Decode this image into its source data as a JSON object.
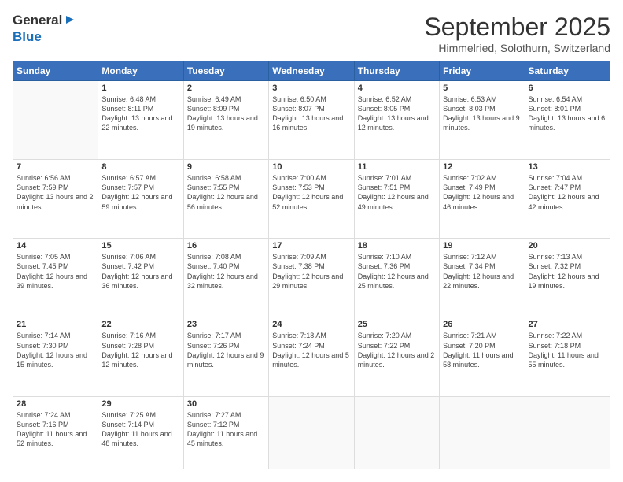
{
  "logo": {
    "general": "General",
    "blue": "Blue"
  },
  "header": {
    "month": "September 2025",
    "location": "Himmelried, Solothurn, Switzerland"
  },
  "weekdays": [
    "Sunday",
    "Monday",
    "Tuesday",
    "Wednesday",
    "Thursday",
    "Friday",
    "Saturday"
  ],
  "weeks": [
    [
      {
        "day": "",
        "info": ""
      },
      {
        "day": "1",
        "info": "Sunrise: 6:48 AM\nSunset: 8:11 PM\nDaylight: 13 hours\nand 22 minutes."
      },
      {
        "day": "2",
        "info": "Sunrise: 6:49 AM\nSunset: 8:09 PM\nDaylight: 13 hours\nand 19 minutes."
      },
      {
        "day": "3",
        "info": "Sunrise: 6:50 AM\nSunset: 8:07 PM\nDaylight: 13 hours\nand 16 minutes."
      },
      {
        "day": "4",
        "info": "Sunrise: 6:52 AM\nSunset: 8:05 PM\nDaylight: 13 hours\nand 12 minutes."
      },
      {
        "day": "5",
        "info": "Sunrise: 6:53 AM\nSunset: 8:03 PM\nDaylight: 13 hours\nand 9 minutes."
      },
      {
        "day": "6",
        "info": "Sunrise: 6:54 AM\nSunset: 8:01 PM\nDaylight: 13 hours\nand 6 minutes."
      }
    ],
    [
      {
        "day": "7",
        "info": "Sunrise: 6:56 AM\nSunset: 7:59 PM\nDaylight: 13 hours\nand 2 minutes."
      },
      {
        "day": "8",
        "info": "Sunrise: 6:57 AM\nSunset: 7:57 PM\nDaylight: 12 hours\nand 59 minutes."
      },
      {
        "day": "9",
        "info": "Sunrise: 6:58 AM\nSunset: 7:55 PM\nDaylight: 12 hours\nand 56 minutes."
      },
      {
        "day": "10",
        "info": "Sunrise: 7:00 AM\nSunset: 7:53 PM\nDaylight: 12 hours\nand 52 minutes."
      },
      {
        "day": "11",
        "info": "Sunrise: 7:01 AM\nSunset: 7:51 PM\nDaylight: 12 hours\nand 49 minutes."
      },
      {
        "day": "12",
        "info": "Sunrise: 7:02 AM\nSunset: 7:49 PM\nDaylight: 12 hours\nand 46 minutes."
      },
      {
        "day": "13",
        "info": "Sunrise: 7:04 AM\nSunset: 7:47 PM\nDaylight: 12 hours\nand 42 minutes."
      }
    ],
    [
      {
        "day": "14",
        "info": "Sunrise: 7:05 AM\nSunset: 7:45 PM\nDaylight: 12 hours\nand 39 minutes."
      },
      {
        "day": "15",
        "info": "Sunrise: 7:06 AM\nSunset: 7:42 PM\nDaylight: 12 hours\nand 36 minutes."
      },
      {
        "day": "16",
        "info": "Sunrise: 7:08 AM\nSunset: 7:40 PM\nDaylight: 12 hours\nand 32 minutes."
      },
      {
        "day": "17",
        "info": "Sunrise: 7:09 AM\nSunset: 7:38 PM\nDaylight: 12 hours\nand 29 minutes."
      },
      {
        "day": "18",
        "info": "Sunrise: 7:10 AM\nSunset: 7:36 PM\nDaylight: 12 hours\nand 25 minutes."
      },
      {
        "day": "19",
        "info": "Sunrise: 7:12 AM\nSunset: 7:34 PM\nDaylight: 12 hours\nand 22 minutes."
      },
      {
        "day": "20",
        "info": "Sunrise: 7:13 AM\nSunset: 7:32 PM\nDaylight: 12 hours\nand 19 minutes."
      }
    ],
    [
      {
        "day": "21",
        "info": "Sunrise: 7:14 AM\nSunset: 7:30 PM\nDaylight: 12 hours\nand 15 minutes."
      },
      {
        "day": "22",
        "info": "Sunrise: 7:16 AM\nSunset: 7:28 PM\nDaylight: 12 hours\nand 12 minutes."
      },
      {
        "day": "23",
        "info": "Sunrise: 7:17 AM\nSunset: 7:26 PM\nDaylight: 12 hours\nand 9 minutes."
      },
      {
        "day": "24",
        "info": "Sunrise: 7:18 AM\nSunset: 7:24 PM\nDaylight: 12 hours\nand 5 minutes."
      },
      {
        "day": "25",
        "info": "Sunrise: 7:20 AM\nSunset: 7:22 PM\nDaylight: 12 hours\nand 2 minutes."
      },
      {
        "day": "26",
        "info": "Sunrise: 7:21 AM\nSunset: 7:20 PM\nDaylight: 11 hours\nand 58 minutes."
      },
      {
        "day": "27",
        "info": "Sunrise: 7:22 AM\nSunset: 7:18 PM\nDaylight: 11 hours\nand 55 minutes."
      }
    ],
    [
      {
        "day": "28",
        "info": "Sunrise: 7:24 AM\nSunset: 7:16 PM\nDaylight: 11 hours\nand 52 minutes."
      },
      {
        "day": "29",
        "info": "Sunrise: 7:25 AM\nSunset: 7:14 PM\nDaylight: 11 hours\nand 48 minutes."
      },
      {
        "day": "30",
        "info": "Sunrise: 7:27 AM\nSunset: 7:12 PM\nDaylight: 11 hours\nand 45 minutes."
      },
      {
        "day": "",
        "info": ""
      },
      {
        "day": "",
        "info": ""
      },
      {
        "day": "",
        "info": ""
      },
      {
        "day": "",
        "info": ""
      }
    ]
  ]
}
